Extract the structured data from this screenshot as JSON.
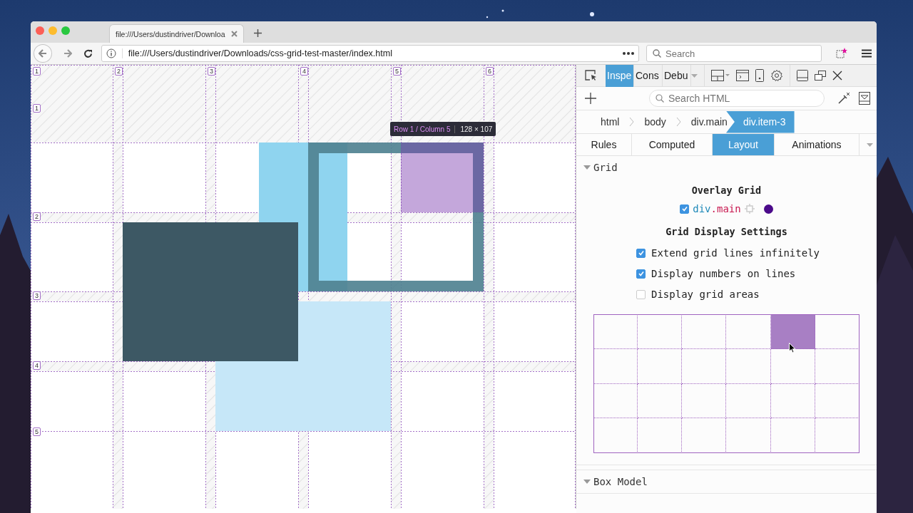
{
  "browser": {
    "tab": {
      "title": "file:///Users/dustindriver/Downloa"
    },
    "url": "file:///Users/dustindriver/Downloads/css-grid-test-master/index.html",
    "search": {
      "placeholder": "Search"
    }
  },
  "page": {
    "column_lines": [
      "1",
      "2",
      "3",
      "4",
      "5",
      "6"
    ],
    "row_lines": [
      "1",
      "2",
      "3",
      "4",
      "5"
    ],
    "tooltip": {
      "cell": "Row 1 / Column 5",
      "size": "128 × 107"
    }
  },
  "devtools": {
    "tabs": [
      {
        "label": "Inspe",
        "selected": true
      },
      {
        "label": "Cons",
        "selected": false
      },
      {
        "label": "Debu",
        "selected": false
      }
    ],
    "search": {
      "placeholder": "Search HTML"
    },
    "breadcrumbs": [
      {
        "label": "html",
        "selected": false
      },
      {
        "label": "body",
        "selected": false
      },
      {
        "label": "div.main",
        "selected": false
      },
      {
        "label": "div.item-3",
        "selected": true
      }
    ],
    "panel_tabs": [
      {
        "label": "Rules",
        "selected": false
      },
      {
        "label": "Computed",
        "selected": false
      },
      {
        "label": "Layout",
        "selected": true
      },
      {
        "label": "Animations",
        "selected": false
      }
    ],
    "grid_section": {
      "title": "Grid",
      "expanded": true,
      "overlay_heading": "Overlay Grid",
      "grids": [
        {
          "tag": "div",
          "class_name": ".main",
          "checked": true,
          "color": "#4b0a8a"
        }
      ],
      "settings_heading": "Grid Display Settings",
      "settings": [
        {
          "label": "Extend grid lines infinitely",
          "checked": true
        },
        {
          "label": "Display numbers on lines",
          "checked": true
        },
        {
          "label": "Display grid areas",
          "checked": false
        }
      ],
      "outline": [
        {
          "cells": [
            {
              "selected": false
            },
            {
              "selected": false
            },
            {
              "selected": false
            },
            {
              "selected": false
            },
            {
              "selected": true
            },
            {
              "selected": false
            }
          ]
        },
        {
          "cells": [
            {
              "selected": false
            },
            {
              "selected": false
            },
            {
              "selected": false
            },
            {
              "selected": false
            },
            {
              "selected": false
            },
            {
              "selected": false
            }
          ]
        },
        {
          "cells": [
            {
              "selected": false
            },
            {
              "selected": false
            },
            {
              "selected": false
            },
            {
              "selected": false
            },
            {
              "selected": false
            },
            {
              "selected": false
            }
          ]
        },
        {
          "cells": [
            {
              "selected": false
            },
            {
              "selected": false
            },
            {
              "selected": false
            },
            {
              "selected": false
            },
            {
              "selected": false
            },
            {
              "selected": false
            }
          ]
        }
      ]
    },
    "box_model": {
      "title": "Box Model",
      "expanded": true
    }
  }
}
